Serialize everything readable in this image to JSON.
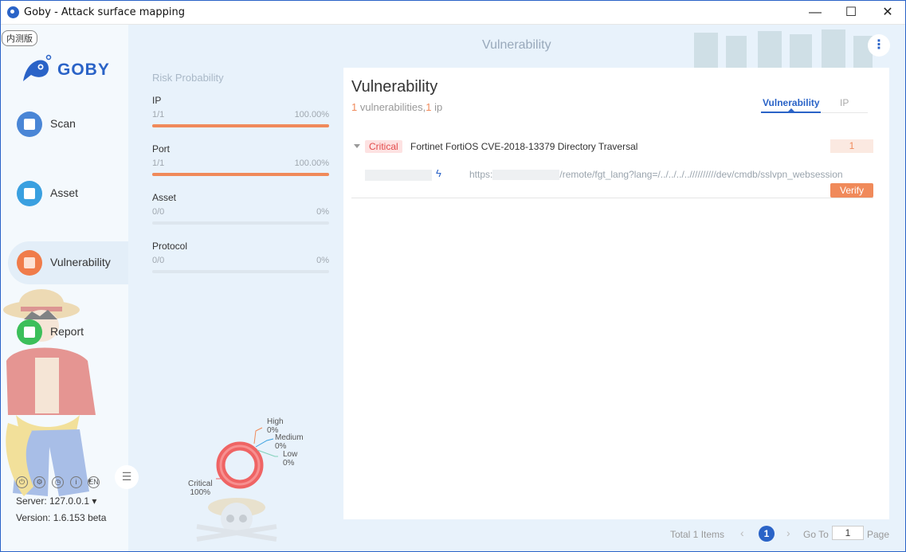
{
  "window": {
    "title": "Goby - Attack surface mapping",
    "minimize": "—",
    "maximize": "☐",
    "close": "✕"
  },
  "sidebar": {
    "beta_badge": "内测版",
    "logo_text": "GOBY",
    "items": [
      {
        "label": "Scan",
        "color": "#4a86d6",
        "icon": "scan-icon"
      },
      {
        "label": "Asset",
        "color": "#3aa0e0",
        "icon": "asset-icon"
      },
      {
        "label": "Vulnerability",
        "color": "#f07c4a",
        "icon": "vulnerability-icon"
      },
      {
        "label": "Report",
        "color": "#3cbf5a",
        "icon": "report-icon"
      }
    ],
    "language": "EN",
    "server": "Server: 127.0.0.1",
    "version": "Version: 1.6.153 beta"
  },
  "header": {
    "title": "Vulnerability"
  },
  "risk": {
    "heading": "Risk Probability",
    "rows": [
      {
        "name": "IP",
        "fraction": "1/1",
        "percent": "100.00%",
        "value": 1.0
      },
      {
        "name": "Port",
        "fraction": "1/1",
        "percent": "100.00%",
        "value": 1.0
      },
      {
        "name": "Asset",
        "fraction": "0/0",
        "percent": "0%",
        "value": 0
      },
      {
        "name": "Protocol",
        "fraction": "0/0",
        "percent": "0%",
        "value": 0
      }
    ]
  },
  "donut": {
    "high_label": "High",
    "high_value": "0%",
    "medium_label": "Medium",
    "medium_value": "0%",
    "low_label": "Low",
    "low_value": "0%",
    "critical_label": "Critical",
    "critical_value": "100%",
    "critical_color": "#ef6464"
  },
  "panel": {
    "title": "Vulnerability",
    "vuln_count": "1",
    "vuln_word": " vulnerabilities,",
    "ip_count": "1",
    "ip_word": " ip",
    "tab_active": "Vulnerability",
    "tab_inactive": "IP"
  },
  "vulns": [
    {
      "severity": "Critical",
      "name": "Fortinet FortiOS CVE-2018-13379 Directory Traversal",
      "count": "1",
      "url_prefix": "https:",
      "url_suffix": "/remote/fgt_lang?lang=/../../../..//////////dev/cmdb/sslvpn_websession",
      "verify": "Verify"
    }
  ],
  "pager": {
    "total": "Total 1 Items",
    "current": "1",
    "goto": "Go To",
    "goto_value": "1",
    "page_word": "Page"
  },
  "colors": {
    "accent": "#2a63c7",
    "orange": "#f08a5a",
    "critical": "#e34c4c"
  }
}
